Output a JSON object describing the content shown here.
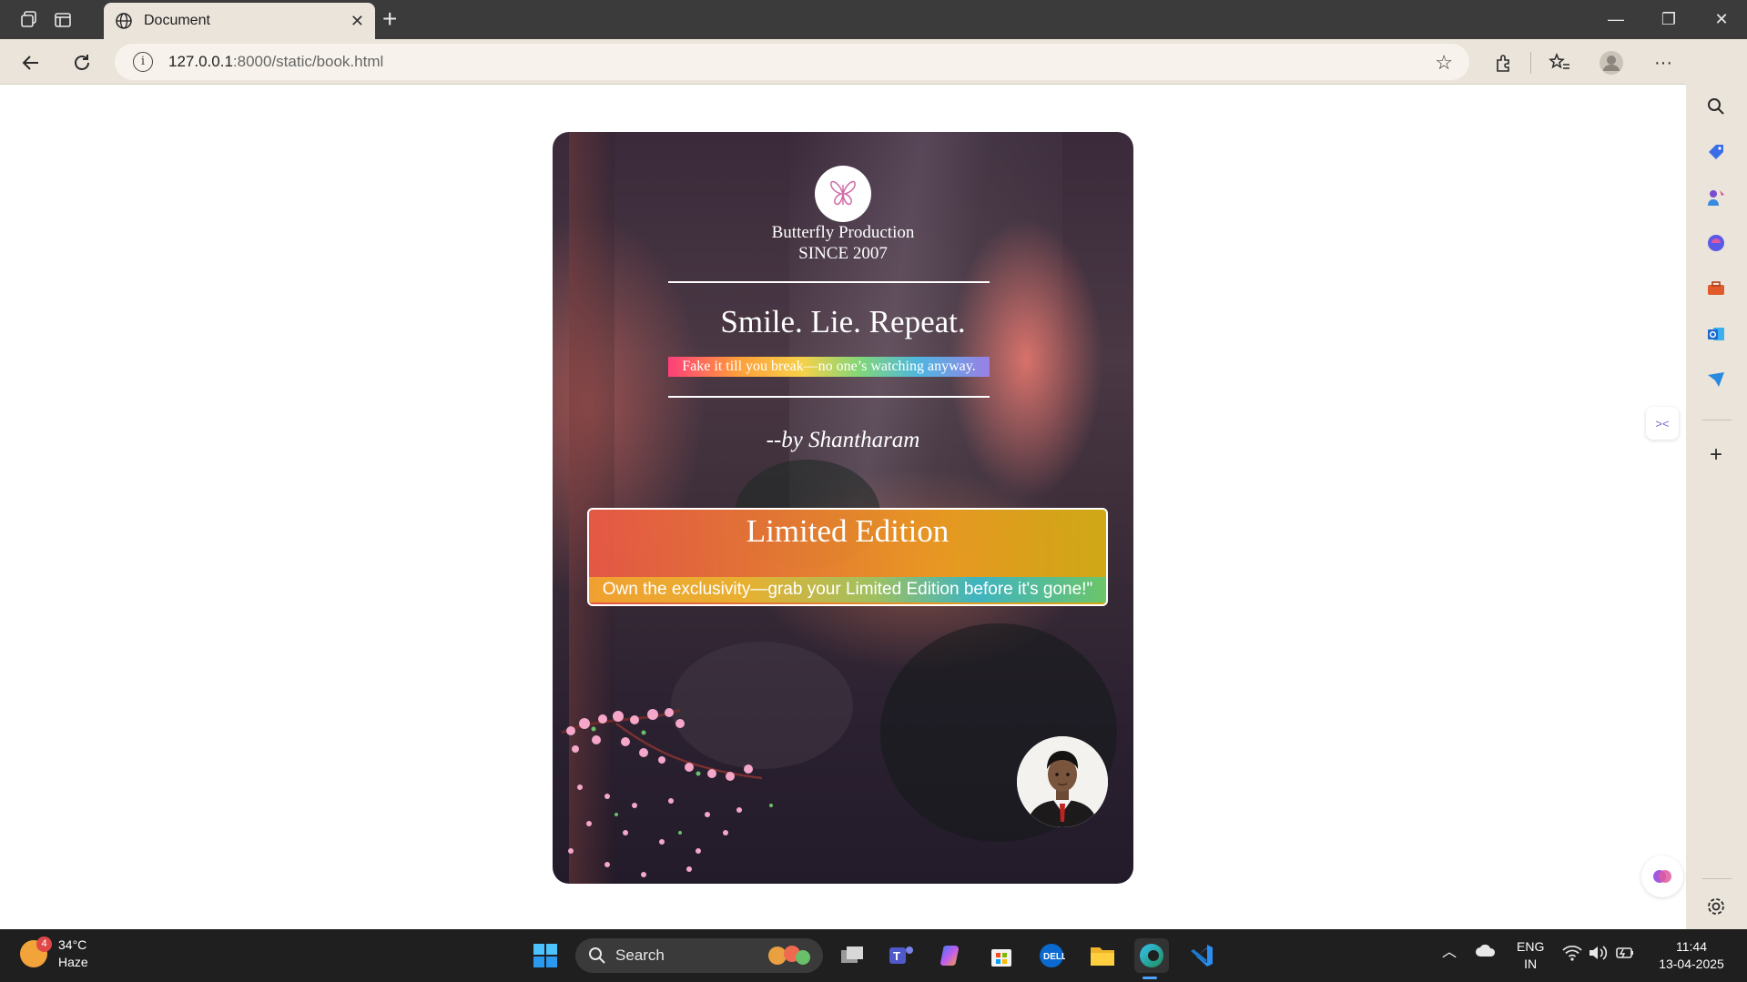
{
  "browser": {
    "tab_title": "Document",
    "url_host": "127.0.0.1",
    "url_rest": ":8000/static/book.html"
  },
  "book": {
    "brand_name": "Butterfly Production",
    "brand_since": "SINCE 2007",
    "headline": "Smile. Lie. Repeat.",
    "tagline": "Fake it till you break—no one’s watching anyway.",
    "author": "--by Shantharam",
    "edition_title": "Limited Edition",
    "edition_subtitle": "Own the exclusivity—grab your Limited Edition before it's gone!\""
  },
  "taskbar": {
    "weather_temp": "34°C",
    "weather_desc": "Haze",
    "weather_badge": "4",
    "search_label": "Search",
    "lang_primary": "ENG",
    "lang_secondary": "IN",
    "time": "11:44",
    "date": "13-04-2025"
  },
  "colors": {
    "tabbar": "#3b3b3b",
    "chrome": "#eae4da",
    "taskbar": "#1f1f1f",
    "edition_gradient_start": "#f05a46",
    "edition_gradient_end": "#d7af14"
  },
  "icons": {
    "tabbar": [
      "workspaces-icon",
      "tab-actions-icon",
      "globe-icon",
      "close-icon",
      "new-tab-icon",
      "minimize-icon",
      "restore-icon",
      "window-close-icon"
    ],
    "addressbar": [
      "back-icon",
      "refresh-icon",
      "site-info-icon",
      "favorite-star-icon",
      "extensions-icon",
      "favorites-icon",
      "profile-icon",
      "more-icon",
      "copilot-icon"
    ],
    "sidebar": [
      "search-icon",
      "shopping-tag-icon",
      "games-icon",
      "copilot-app-icon",
      "tools-icon",
      "outlook-icon",
      "send-icon",
      "add-icon",
      "settings-icon"
    ]
  }
}
